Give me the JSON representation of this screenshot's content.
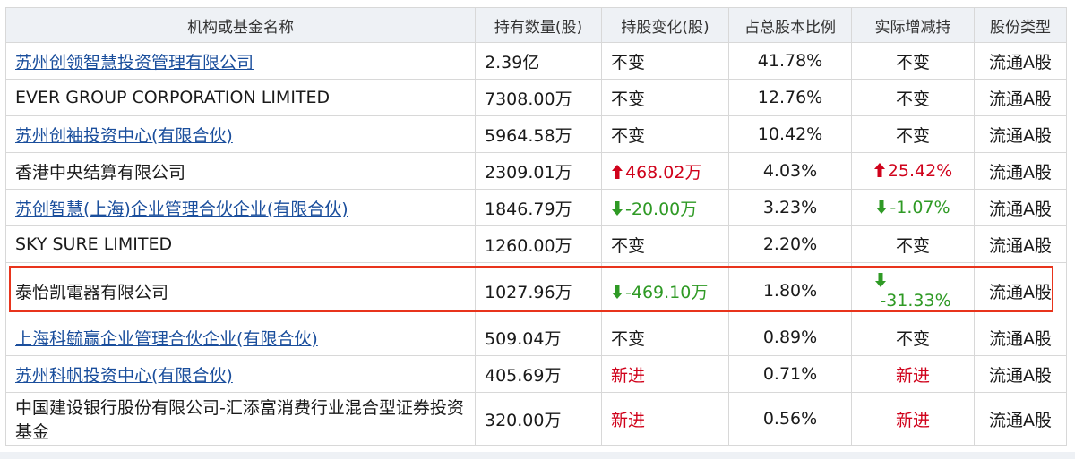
{
  "table": {
    "headers": [
      "机构或基金名称",
      "持有数量(股)",
      "持股变化(股)",
      "占总股本比例",
      "实际增减持",
      "股份类型"
    ],
    "rows": [
      {
        "name": "苏州创领智慧投资管理有限公司",
        "link": true,
        "shares": "2.39亿",
        "change": "不变",
        "change_dir": "none",
        "ratio": "41.78%",
        "actual": "不变",
        "actual_dir": "none",
        "type": "流通A股"
      },
      {
        "name": "EVER GROUP CORPORATION LIMITED",
        "link": false,
        "shares": "7308.00万",
        "change": "不变",
        "change_dir": "none",
        "ratio": "12.76%",
        "actual": "不变",
        "actual_dir": "none",
        "type": "流通A股"
      },
      {
        "name": "苏州创袖投资中心(有限合伙)",
        "link": true,
        "shares": "5964.58万",
        "change": "不变",
        "change_dir": "none",
        "ratio": "10.42%",
        "actual": "不变",
        "actual_dir": "none",
        "type": "流通A股"
      },
      {
        "name": "香港中央结算有限公司",
        "link": false,
        "shares": "2309.01万",
        "change": "468.02万",
        "change_dir": "up",
        "ratio": "4.03%",
        "actual": "25.42%",
        "actual_dir": "up",
        "type": "流通A股"
      },
      {
        "name": "苏创智慧(上海)企业管理合伙企业(有限合伙)",
        "link": true,
        "shares": "1846.79万",
        "change": "-20.00万",
        "change_dir": "down",
        "ratio": "3.23%",
        "actual": "-1.07%",
        "actual_dir": "down",
        "type": "流通A股"
      },
      {
        "name": "SKY SURE LIMITED",
        "link": false,
        "shares": "1260.00万",
        "change": "不变",
        "change_dir": "none",
        "ratio": "2.20%",
        "actual": "不变",
        "actual_dir": "none",
        "type": "流通A股"
      },
      {
        "name": "泰怡凯電器有限公司",
        "link": false,
        "shares": "1027.96万",
        "change": "-469.10万",
        "change_dir": "down",
        "ratio": "1.80%",
        "actual": "-31.33%",
        "actual_dir": "down",
        "type": "流通A股",
        "highlighted": true
      },
      {
        "name": "上海科毓赢企业管理合伙企业(有限合伙)",
        "link": true,
        "shares": "509.04万",
        "change": "不变",
        "change_dir": "none",
        "ratio": "0.89%",
        "actual": "不变",
        "actual_dir": "none",
        "type": "流通A股"
      },
      {
        "name": "苏州科帆投资中心(有限合伙)",
        "link": true,
        "shares": "405.69万",
        "change": "新进",
        "change_dir": "new",
        "ratio": "0.71%",
        "actual": "新进",
        "actual_dir": "new",
        "type": "流通A股"
      },
      {
        "name": "中国建设银行股份有限公司-汇添富消费行业混合型证券投资基金",
        "link": false,
        "shares": "320.00万",
        "change": "新进",
        "change_dir": "new",
        "ratio": "0.56%",
        "actual": "新进",
        "actual_dir": "new",
        "type": "流通A股"
      }
    ]
  },
  "colors": {
    "up": "#d0021b",
    "down": "#2f9a25",
    "link": "#1a4e9c",
    "highlight_border": "#e8341c",
    "header_bg": "#eef1f5"
  },
  "icons": {
    "up": "arrow-up-icon",
    "down": "arrow-down-icon"
  }
}
